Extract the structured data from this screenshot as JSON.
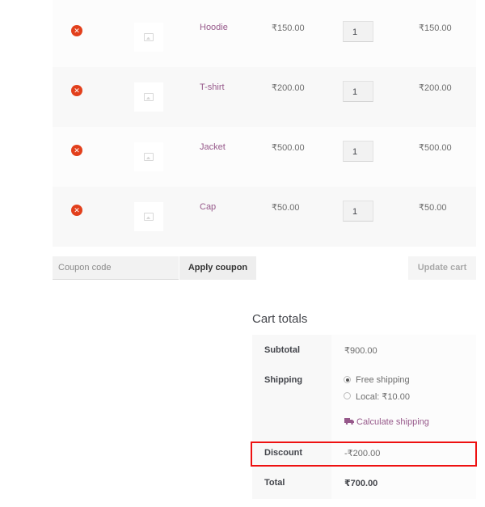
{
  "cart": {
    "items": [
      {
        "name": "Hoodie",
        "price": "₹150.00",
        "quantity": "1",
        "subtotal": "₹150.00"
      },
      {
        "name": "T-shirt",
        "price": "₹200.00",
        "quantity": "1",
        "subtotal": "₹200.00"
      },
      {
        "name": "Jacket",
        "price": "₹500.00",
        "quantity": "1",
        "subtotal": "₹500.00"
      },
      {
        "name": "Cap",
        "price": "₹50.00",
        "quantity": "1",
        "subtotal": "₹50.00"
      }
    ],
    "remove_symbol": "✕"
  },
  "actions": {
    "coupon_placeholder": "Coupon code",
    "apply_coupon_label": "Apply coupon",
    "update_cart_label": "Update cart"
  },
  "totals": {
    "title": "Cart totals",
    "subtotal_label": "Subtotal",
    "subtotal_value": "₹900.00",
    "shipping_label": "Shipping",
    "shipping_options": [
      {
        "label": "Free shipping",
        "selected": true
      },
      {
        "label": "Local: ₹10.00",
        "selected": false
      }
    ],
    "calculate_shipping": "Calculate shipping",
    "discount_label": "Discount",
    "discount_value": "-₹200.00",
    "total_label": "Total",
    "total_value": "₹700.00"
  },
  "colors": {
    "link": "#96588a",
    "remove": "#e2401c",
    "highlight": "#ee1111"
  }
}
